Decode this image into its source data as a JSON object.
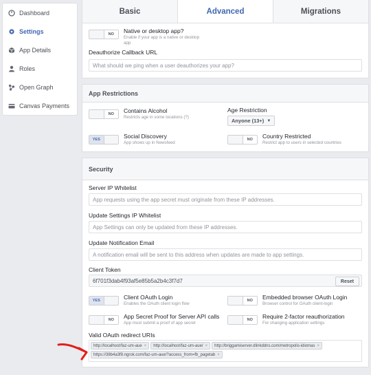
{
  "sidebar": {
    "items": [
      {
        "label": "Dashboard",
        "icon": "dashboard-icon"
      },
      {
        "label": "Settings",
        "icon": "settings-icon",
        "active": true
      },
      {
        "label": "App Details",
        "icon": "cube-icon"
      },
      {
        "label": "Roles",
        "icon": "person-icon"
      },
      {
        "label": "Open Graph",
        "icon": "graph-icon"
      },
      {
        "label": "Canvas Payments",
        "icon": "card-icon"
      }
    ]
  },
  "tabs": [
    "Basic",
    "Advanced",
    "Migrations"
  ],
  "toggle_labels": {
    "no": "NO",
    "yes": "YES"
  },
  "top": {
    "native_title": "Native or desktop app?",
    "native_sub1": "Enable if your app is a native or desktop",
    "native_sub2": "app",
    "deauth_label": "Deauthorize Callback URL",
    "deauth_placeholder": "What should we ping when a user deauthorizes your app?"
  },
  "restrictions": {
    "title": "App Restrictions",
    "alcohol_title": "Contains Alcohol",
    "alcohol_sub": "Restricts age in some locations (?)",
    "age_label": "Age Restriction",
    "age_value": "Anyone (13+)",
    "social_title": "Social Discovery",
    "social_sub": "App shows up in Newsfeed",
    "country_title": "Country Restricted",
    "country_sub": "Restrict app to users in selected countries"
  },
  "security": {
    "title": "Security",
    "server_ip_label": "Server IP Whitelist",
    "server_ip_placeholder": "App requests using the app secret must originate from these IP addresses.",
    "update_ip_label": "Update Settings IP Whitelist",
    "update_ip_placeholder": "App Settings can only be updated from these IP addresses.",
    "email_label": "Update Notification Email",
    "email_placeholder": "A notification email will be sent to this address when updates are made to app settings.",
    "token_label": "Client Token",
    "token_value": "6f701f3dab4f93af5e85b5a2b4c3f7d7",
    "reset_label": "Reset",
    "client_oauth_title": "Client OAuth Login",
    "client_oauth_sub": "Enables the OAuth client login flow",
    "embedded_title": "Embedded browser OAuth Login",
    "embedded_sub": "Browser control for OAuth client-login",
    "proof_title": "App Secret Proof for Server API calls",
    "proof_sub": "App must submit a proof of app secret",
    "twofactor_title": "Require 2-factor reauthorization",
    "twofactor_sub": "For changing application settings",
    "redirect_label": "Valid OAuth redirect URIs",
    "redirect_uris": [
      "http://localhost/faz-um-aue",
      "http://localhost/faz-um-aue/",
      "http://briggamiserver.dlinkddns.com/metropolis-idiomas",
      "https://38b4a3f8.ngrok.com/faz-um-aue/?access_from=fb_pagetab"
    ]
  },
  "colors": {
    "accent": "#4267b2",
    "arrow": "#e0201a"
  }
}
